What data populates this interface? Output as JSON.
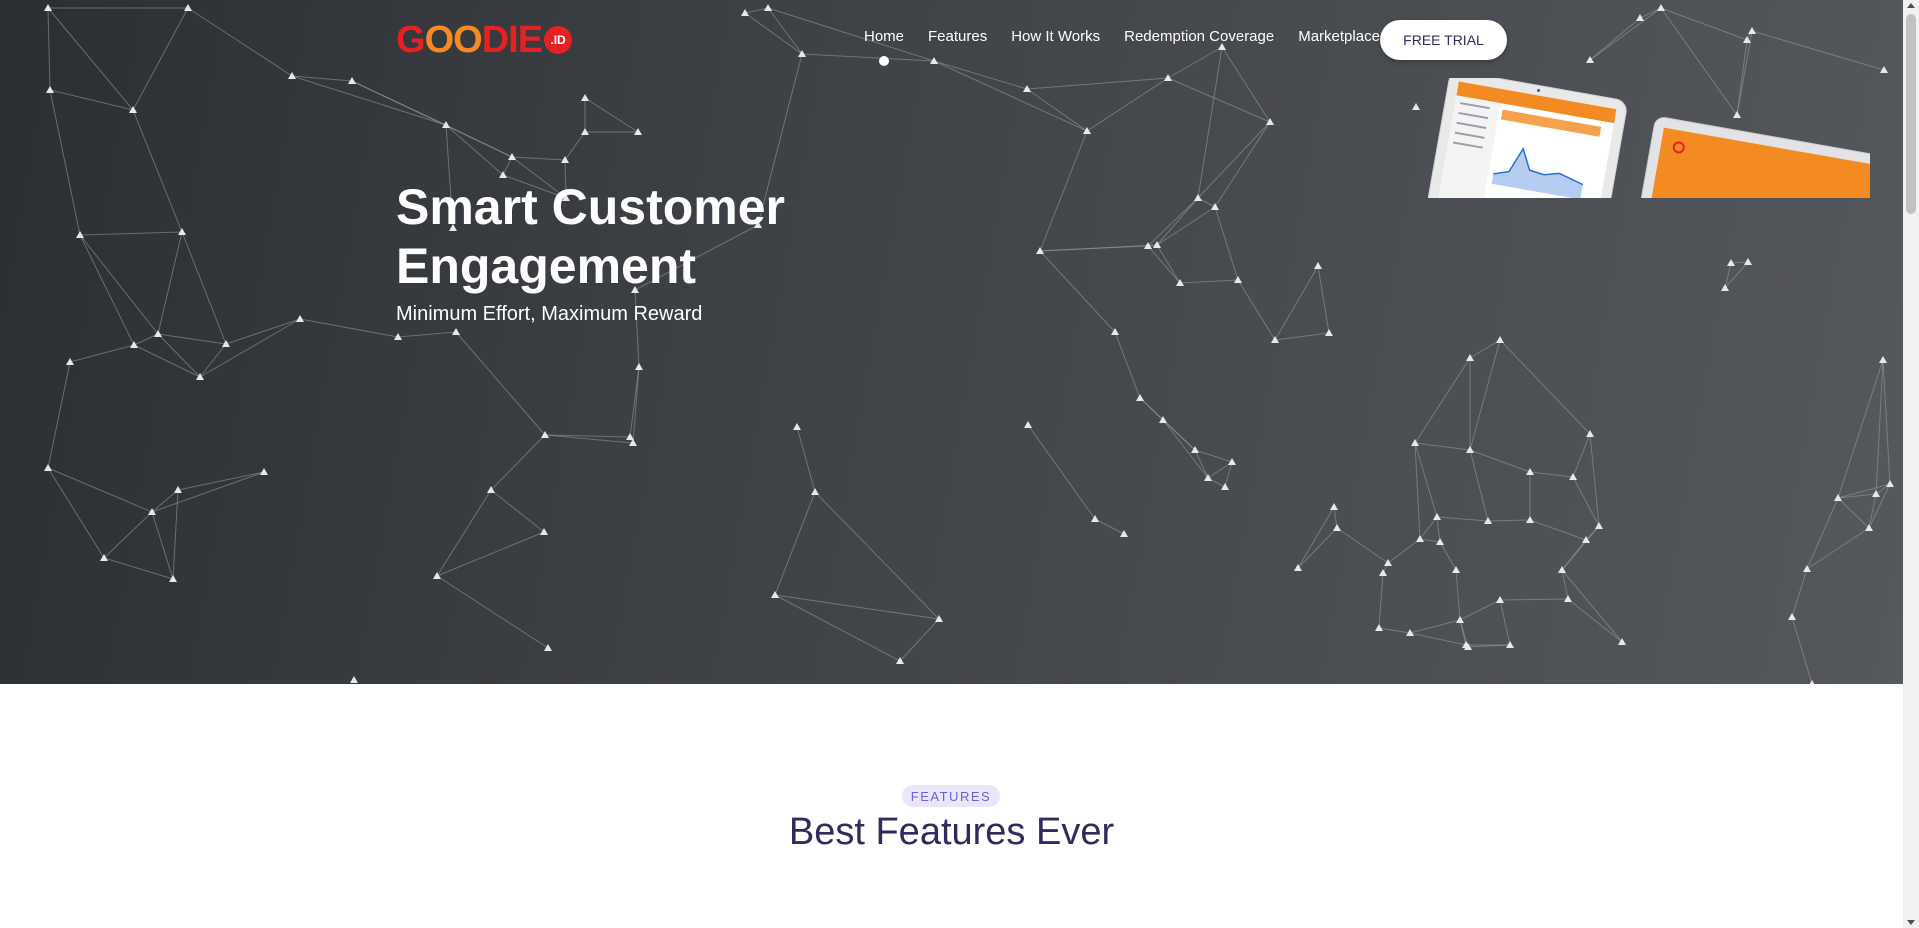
{
  "brand": {
    "logo_g": "G",
    "logo_oo": "OO",
    "logo_die": "DIE",
    "logo_badge": ".ID"
  },
  "nav": {
    "items": [
      {
        "label": "Home",
        "active": true
      },
      {
        "label": "Features",
        "active": false
      },
      {
        "label": "How It Works",
        "active": false
      },
      {
        "label": "Redemption Coverage",
        "active": false
      },
      {
        "label": "Marketplace",
        "active": false
      }
    ],
    "cta_label": "FREE TRIAL"
  },
  "hero": {
    "title": "Smart Customer Engagement",
    "subtitle": "Minimum Effort, Maximum Reward"
  },
  "features_section": {
    "tag": "FEATURES",
    "title": "Best Features Ever"
  },
  "colors": {
    "brand_red": "#e52222",
    "brand_orange": "#f38a22",
    "heading_navy": "#2f2b5c",
    "tag_purple": "#6a63d6"
  }
}
